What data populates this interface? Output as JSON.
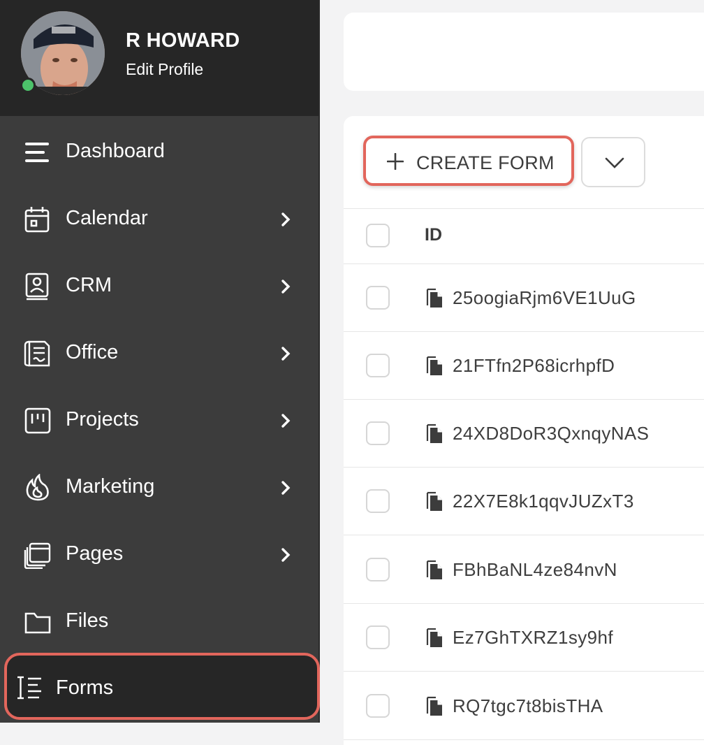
{
  "profile": {
    "name": "R HOWARD",
    "edit_label": "Edit Profile",
    "status_color": "#4cc26a"
  },
  "sidebar": {
    "items": [
      {
        "label": "Dashboard",
        "icon": "menu-icon",
        "has_submenu": false
      },
      {
        "label": "Calendar",
        "icon": "calendar-icon",
        "has_submenu": true
      },
      {
        "label": "CRM",
        "icon": "contact-book-icon",
        "has_submenu": true
      },
      {
        "label": "Office",
        "icon": "document-scroll-icon",
        "has_submenu": true
      },
      {
        "label": "Projects",
        "icon": "kanban-icon",
        "has_submenu": true
      },
      {
        "label": "Marketing",
        "icon": "flame-icon",
        "has_submenu": true
      },
      {
        "label": "Pages",
        "icon": "pages-stack-icon",
        "has_submenu": true
      },
      {
        "label": "Files",
        "icon": "folder-icon",
        "has_submenu": false
      },
      {
        "label": "Forms",
        "icon": "form-list-icon",
        "has_submenu": false,
        "active": true
      }
    ]
  },
  "toolbar": {
    "create_label": "CREATE FORM",
    "create_icon": "plus-icon",
    "dropdown_icon": "chevron-down-icon"
  },
  "table": {
    "columns": [
      "ID"
    ],
    "rows": [
      {
        "id": "25oogiaRjm6VE1UuG"
      },
      {
        "id": "21FTfn2P68icrhpfD"
      },
      {
        "id": "24XD8DoR3QxnqyNAS"
      },
      {
        "id": "22X7E8k1qqvJUZxT3"
      },
      {
        "id": "FBhBaNL4ze84nvN"
      },
      {
        "id": "Ez7GhTXRZ1sy9hf"
      },
      {
        "id": "RQ7tgc7t8bisTHA"
      }
    ]
  },
  "colors": {
    "highlight": "#e2665c",
    "sidebar_bg": "#3c3c3c",
    "sidebar_header_bg": "#262626"
  }
}
